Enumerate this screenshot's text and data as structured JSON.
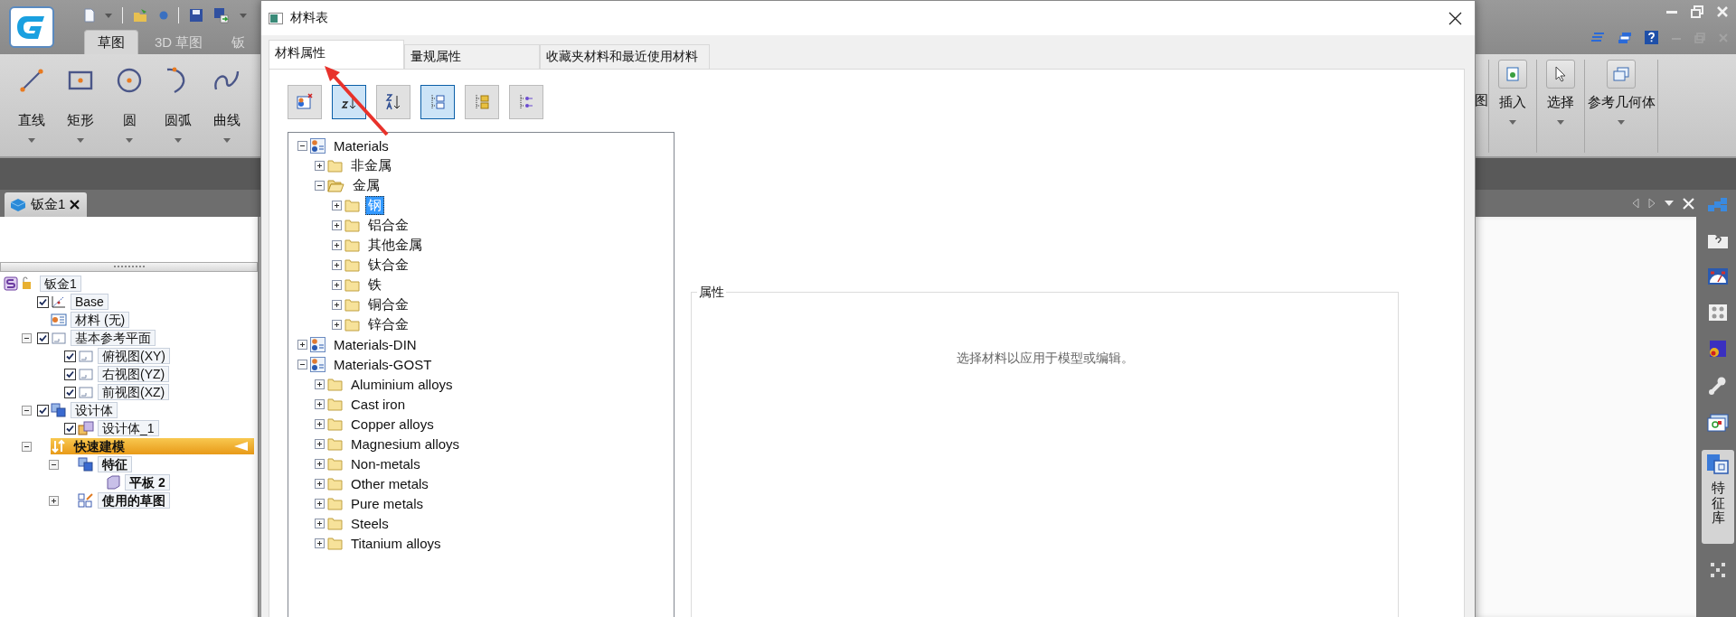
{
  "app": {
    "ribbon_tabs": [
      {
        "label": "草图",
        "selected": true
      },
      {
        "label": "3D 草图",
        "selected": false
      },
      {
        "label": "钣",
        "selected": false
      }
    ],
    "sketch_tools": [
      {
        "label": "直线",
        "kind": "line"
      },
      {
        "label": "矩形",
        "kind": "rect"
      },
      {
        "label": "圆",
        "kind": "circle"
      },
      {
        "label": "圆弧",
        "kind": "arc"
      },
      {
        "label": "曲线",
        "kind": "curve"
      }
    ],
    "ribbon_groups": [
      {
        "label": "图",
        "kind": "cut"
      },
      {
        "label": "插入",
        "kind": "insert"
      },
      {
        "label": "选择",
        "kind": "select"
      },
      {
        "label": "参考几何体",
        "kind": "refgeom"
      }
    ],
    "document_tab": {
      "label": "钣金1"
    },
    "feature_tree": [
      {
        "label": "钣金1",
        "kind": "part",
        "children": [
          {
            "label": "Base",
            "kind": "sketch",
            "checked": true
          },
          {
            "label": "材料 (无)",
            "kind": "material"
          },
          {
            "label": "基本参考平面",
            "kind": "plane",
            "checked": true,
            "expanded": true,
            "children": [
              {
                "label": "俯视图(XY)",
                "kind": "plane",
                "checked": true
              },
              {
                "label": "右视图(YZ)",
                "kind": "plane",
                "checked": true
              },
              {
                "label": "前视图(XZ)",
                "kind": "plane",
                "checked": true
              }
            ]
          },
          {
            "label": "设计体",
            "kind": "body",
            "checked": true,
            "expanded": true,
            "children": [
              {
                "label": "设计体_1",
                "kind": "body-item",
                "checked": true
              }
            ]
          },
          {
            "label": "快速建模",
            "kind": "quick",
            "expanded": true,
            "bold": true,
            "highlighted": true,
            "children": [
              {
                "label": "特征",
                "kind": "body",
                "expanded": true,
                "bold": true,
                "children": [
                  {
                    "label": "平板 2",
                    "kind": "plate",
                    "bold": true
                  }
                ]
              },
              {
                "label": "使用的草图",
                "kind": "sketches",
                "expanded": false,
                "bold": true
              }
            ]
          }
        ]
      }
    ],
    "side_tab": {
      "label": "特征库"
    }
  },
  "dialog": {
    "title": "材料表",
    "tabs": [
      {
        "label": "材料属性",
        "selected": true
      },
      {
        "label": "量规属性",
        "selected": false
      },
      {
        "label": "收藏夹材料和最近使用材料",
        "selected": false
      }
    ],
    "toolbar": [
      {
        "kind": "add",
        "on": false
      },
      {
        "kind": "sort-az",
        "on": true
      },
      {
        "kind": "sort-za",
        "on": false
      },
      {
        "kind": "tree",
        "on": true
      },
      {
        "kind": "folders",
        "on": false
      },
      {
        "kind": "list",
        "on": false
      }
    ],
    "tree": [
      {
        "label": "Materials",
        "kind": "library",
        "expanded": true,
        "selected": false,
        "children": [
          {
            "label": "非金属",
            "kind": "folder",
            "expanded": false,
            "selected": false
          },
          {
            "label": "金属",
            "kind": "folder",
            "expanded": true,
            "selected": false,
            "children": [
              {
                "label": "钢",
                "kind": "folder",
                "expanded": false,
                "selected": true
              },
              {
                "label": "铝合金",
                "kind": "folder",
                "expanded": false,
                "selected": false
              },
              {
                "label": "其他金属",
                "kind": "folder",
                "expanded": false,
                "selected": false
              },
              {
                "label": "钛合金",
                "kind": "folder",
                "expanded": false,
                "selected": false
              },
              {
                "label": "铁",
                "kind": "folder",
                "expanded": false,
                "selected": false
              },
              {
                "label": "铜合金",
                "kind": "folder",
                "expanded": false,
                "selected": false
              },
              {
                "label": "锌合金",
                "kind": "folder",
                "expanded": false,
                "selected": false
              }
            ]
          }
        ]
      },
      {
        "label": "Materials-DIN",
        "kind": "library",
        "expanded": false,
        "selected": false
      },
      {
        "label": "Materials-GOST",
        "kind": "library",
        "expanded": true,
        "selected": false,
        "children": [
          {
            "label": "Aluminium alloys",
            "kind": "folder",
            "expanded": false,
            "selected": false
          },
          {
            "label": "Cast iron",
            "kind": "folder",
            "expanded": false,
            "selected": false
          },
          {
            "label": "Copper alloys",
            "kind": "folder",
            "expanded": false,
            "selected": false
          },
          {
            "label": "Magnesium alloys",
            "kind": "folder",
            "expanded": false,
            "selected": false
          },
          {
            "label": "Non-metals",
            "kind": "folder",
            "expanded": false,
            "selected": false
          },
          {
            "label": "Other metals",
            "kind": "folder",
            "expanded": false,
            "selected": false
          },
          {
            "label": "Pure metals",
            "kind": "folder",
            "expanded": false,
            "selected": false
          },
          {
            "label": "Steels",
            "kind": "folder",
            "expanded": false,
            "selected": false
          },
          {
            "label": "Titanium alloys",
            "kind": "folder",
            "expanded": false,
            "selected": false
          }
        ]
      }
    ],
    "properties": {
      "title": "属性",
      "message": "选择材料以应用于模型或编辑。"
    }
  }
}
